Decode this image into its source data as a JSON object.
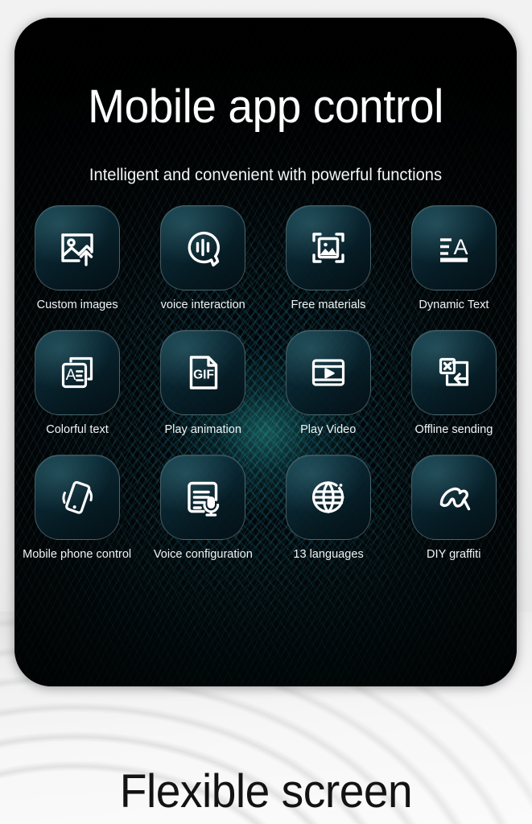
{
  "header": {
    "title": "Mobile app control",
    "subtitle": "Intelligent and convenient with powerful functions"
  },
  "features": [
    {
      "label": "Custom images",
      "icon": "image-upload-icon"
    },
    {
      "label": "voice interaction",
      "icon": "voice-bubble-icon"
    },
    {
      "label": "Free materials",
      "icon": "image-frame-icon"
    },
    {
      "label": "Dynamic Text",
      "icon": "text-lines-a-icon"
    },
    {
      "label": "Colorful text",
      "icon": "text-card-a-icon"
    },
    {
      "label": "Play animation",
      "icon": "gif-file-icon"
    },
    {
      "label": "Play Video",
      "icon": "video-player-icon"
    },
    {
      "label": "Offline sending",
      "icon": "offline-send-icon"
    },
    {
      "label": "Mobile phone control",
      "icon": "shaking-phone-icon"
    },
    {
      "label": "Voice configuration",
      "icon": "document-microphone-icon"
    },
    {
      "label": "13 languages",
      "icon": "globe-icon"
    },
    {
      "label": "DIY graffiti",
      "icon": "graffiti-brush-icon"
    }
  ],
  "footer": {
    "heading": "Flexible screen"
  },
  "colors": {
    "panel_background": "#020608",
    "accent_teal": "#34c4be",
    "tile_border": "#bed2d7",
    "title_text": "#ffffff",
    "footer_text": "#131313",
    "page_background": "#efefef"
  }
}
